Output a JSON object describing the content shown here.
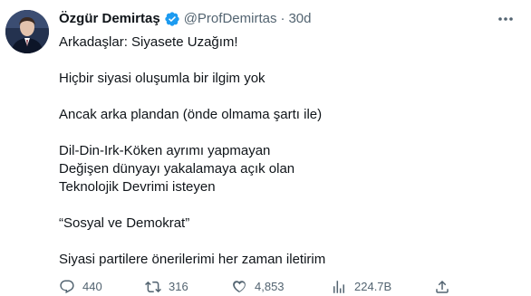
{
  "author": {
    "name": "Özgür Demirtaş",
    "handle": "@ProfDemirtas",
    "separator": "·",
    "time": "30d",
    "verified": true
  },
  "tweet": {
    "lines": [
      "Arkadaşlar: Siyasete Uzağım!",
      "",
      "Hiçbir siyasi oluşumla bir ilgim yok",
      "",
      "Ancak arka plandan (önde olmama şartı ile)",
      "",
      "Dil-Din-Irk-Köken ayrımı yapmayan",
      "Değişen dünyayı yakalamaya açık olan",
      "Teknolojik Devrimi isteyen",
      "",
      "“Sosyal ve Demokrat”",
      "",
      "Siyasi partilere önerilerimi her zaman iletirim"
    ]
  },
  "actions": {
    "replies": "440",
    "retweets": "316",
    "likes": "4,853",
    "views": "224.7B",
    "icons": [
      "reply-icon",
      "retweet-icon",
      "like-icon",
      "views-icon",
      "share-icon"
    ]
  },
  "colors": {
    "text": "#0f1419",
    "muted": "#536471",
    "verified": "#1d9bf0"
  }
}
